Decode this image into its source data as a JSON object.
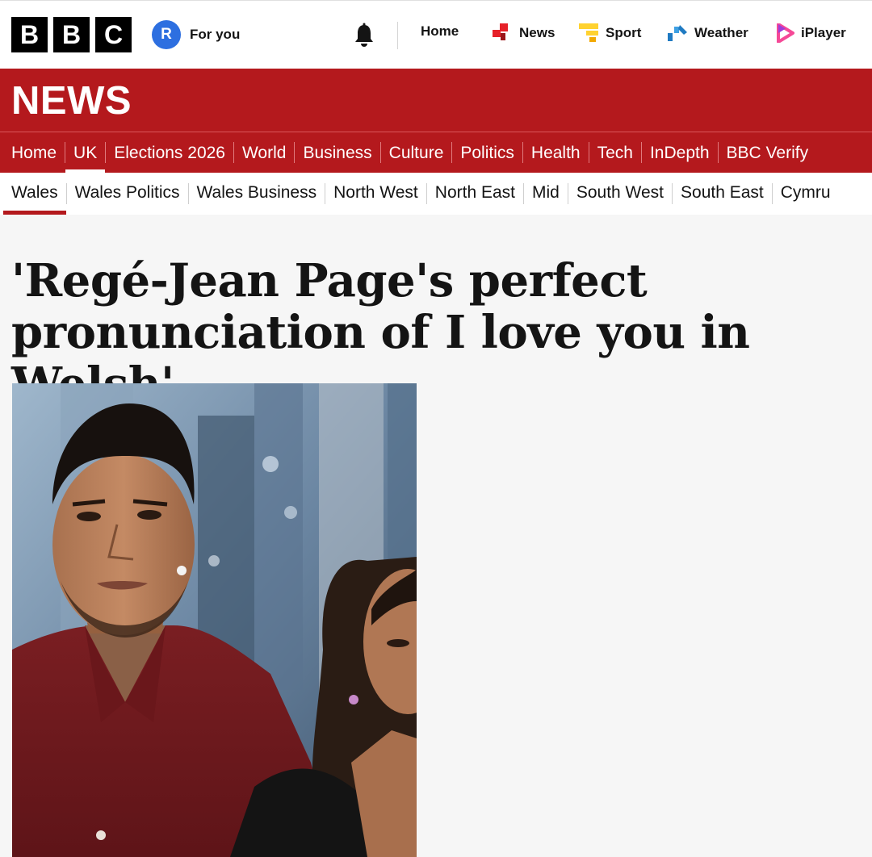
{
  "brand": {
    "letters": [
      "B",
      "B",
      "C"
    ]
  },
  "account": {
    "initial": "R",
    "label": "For you"
  },
  "global_nav": {
    "notifications_icon": "bell-icon",
    "items": [
      {
        "label": "Home",
        "icon": ""
      },
      {
        "label": "News",
        "icon": "news-icon",
        "color": "#e62129"
      },
      {
        "label": "Sport",
        "icon": "sport-icon",
        "color": "#ffd230"
      },
      {
        "label": "Weather",
        "icon": "weather-icon",
        "color": "#1f7ac2"
      },
      {
        "label": "iPlayer",
        "icon": "iplayer-play-icon",
        "color": "#f54997"
      }
    ]
  },
  "section_title": "NEWS",
  "primary_nav": {
    "active": "UK",
    "items": [
      "Home",
      "UK",
      "Elections 2026",
      "World",
      "Business",
      "Culture",
      "Politics",
      "Health",
      "Tech",
      "InDepth",
      "BBC Verify"
    ]
  },
  "secondary_nav": {
    "active": "Wales",
    "items": [
      "Wales",
      "Wales Politics",
      "Wales Business",
      "North West",
      "North East",
      "Mid",
      "South West",
      "South East",
      "Cymru"
    ]
  },
  "article": {
    "headline_line1": "'Regé-Jean Page's perfect",
    "headline_line2": "pronunciation of I love you in Welsh'"
  },
  "colors": {
    "news_red": "#b4191d",
    "avatar_blue": "#2d6fe0"
  }
}
